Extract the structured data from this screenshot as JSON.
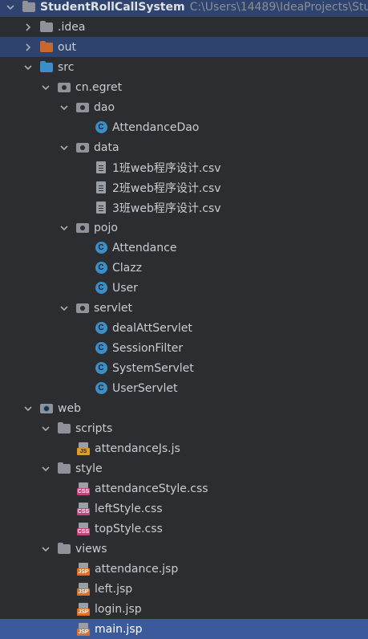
{
  "project": {
    "name": "StudentRollCallSystem",
    "path": "C:\\Users\\14489\\IdeaProjects\\Stu"
  },
  "items": [
    {
      "label": ".idea"
    },
    {
      "label": "out"
    },
    {
      "label": "src"
    },
    {
      "label": "cn.egret"
    },
    {
      "label": "dao"
    },
    {
      "label": "AttendanceDao"
    },
    {
      "label": "data"
    },
    {
      "label": "1班web程序设计.csv"
    },
    {
      "label": "2班web程序设计.csv"
    },
    {
      "label": "3班web程序设计.csv"
    },
    {
      "label": "pojo"
    },
    {
      "label": "Attendance"
    },
    {
      "label": "Clazz"
    },
    {
      "label": "User"
    },
    {
      "label": "servlet"
    },
    {
      "label": "dealAttServlet"
    },
    {
      "label": "SessionFilter"
    },
    {
      "label": "SystemServlet"
    },
    {
      "label": "UserServlet"
    },
    {
      "label": "web"
    },
    {
      "label": "scripts"
    },
    {
      "label": "attendanceJs.js"
    },
    {
      "label": "style"
    },
    {
      "label": "attendanceStyle.css"
    },
    {
      "label": "leftStyle.css"
    },
    {
      "label": "topStyle.css"
    },
    {
      "label": "views"
    },
    {
      "label": "attendance.jsp"
    },
    {
      "label": "left.jsp"
    },
    {
      "label": "login.jsp"
    },
    {
      "label": "main.jsp"
    }
  ],
  "icons": {
    "class_letter": "C",
    "js_tag": "JS",
    "css_tag": "CSS",
    "jsp_tag": "JSP"
  },
  "colors": {
    "background": "#2b2d30",
    "selection_light": "#2e436e",
    "selection_strong": "#3a5a9c",
    "folder_excluded": "#c9682c",
    "folder_source": "#3b8fc8",
    "class_icon": "#3b8fc8"
  }
}
